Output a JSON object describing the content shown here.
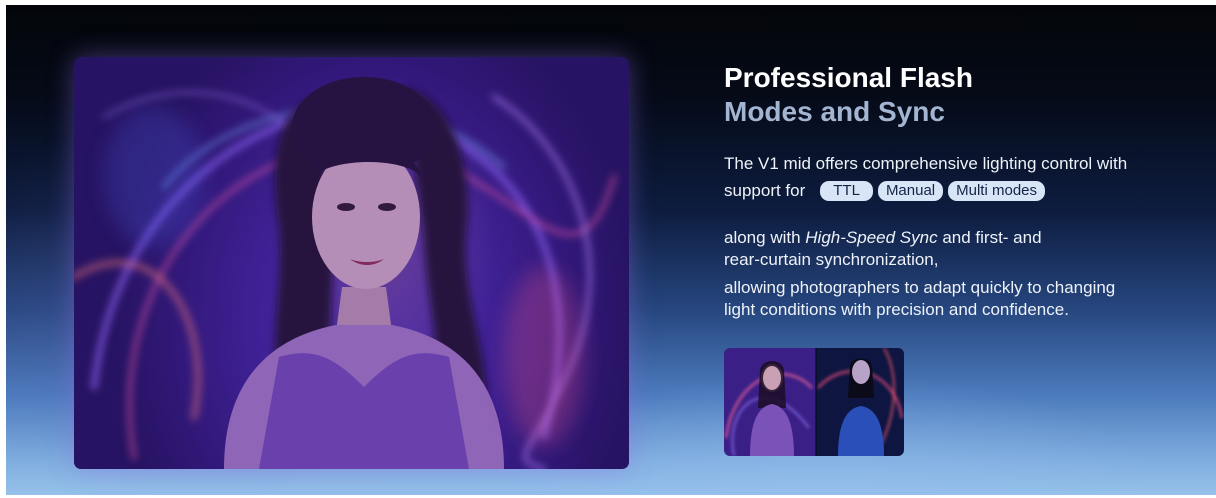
{
  "section": {
    "title_line1": "Professional Flash",
    "title_line2": "Modes and Sync",
    "intro": "The V1 mid offers comprehensive lighting control with",
    "modes_lead": "support for",
    "modes": [
      "TTL",
      "Manual",
      "Multi modes"
    ],
    "sync_prefix": "along with ",
    "sync_emphasis": "High-Speed Sync",
    "sync_suffix": " and first- and",
    "sync_line2": "rear-curtain synchronization,",
    "closing_line1": "allowing photographers to adapt quickly to changing",
    "closing_line2": "light conditions with precision and confidence."
  },
  "colors": {
    "title_primary": "#ffffff",
    "title_secondary": "#a3b5d1",
    "pill_background": "#d8e5f6",
    "pill_text": "#142447"
  }
}
